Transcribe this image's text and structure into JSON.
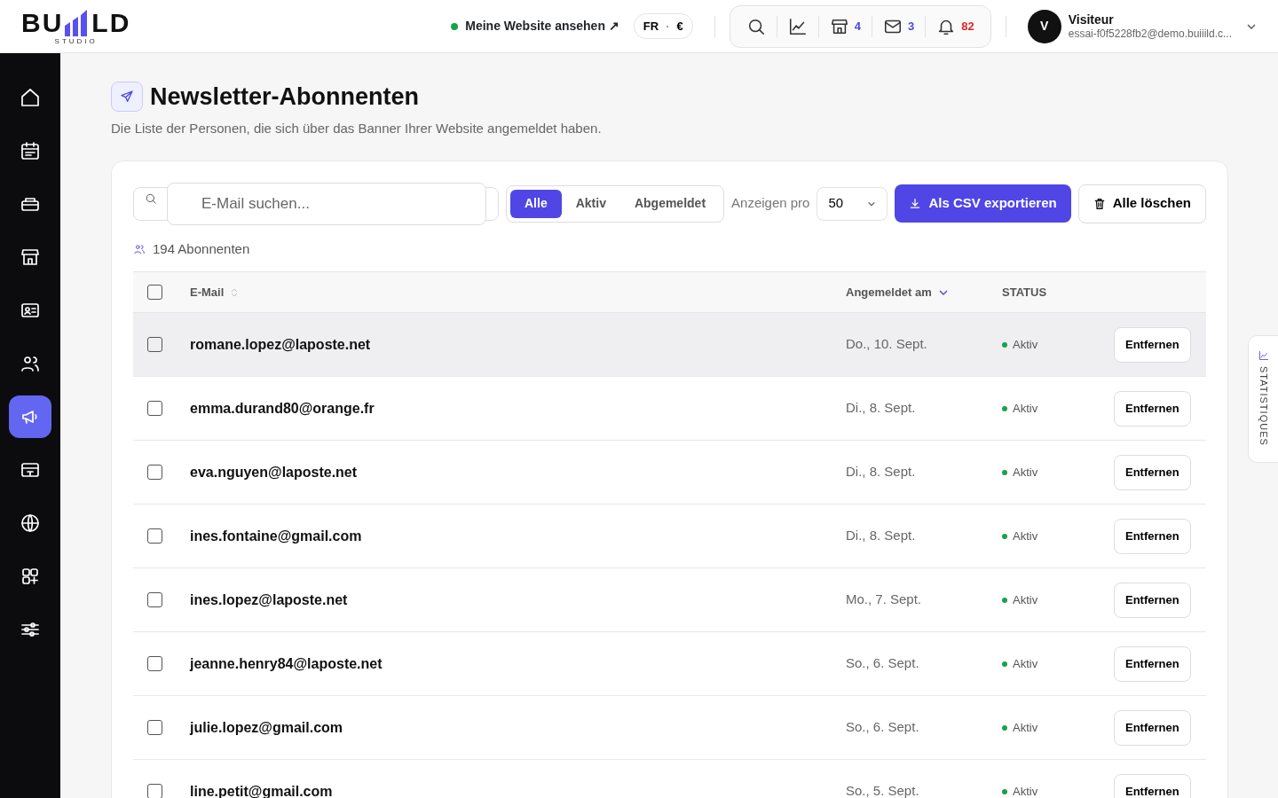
{
  "header": {
    "logo_text_left": "BU",
    "logo_text_right": "LD",
    "logo_sub": "STUDIO",
    "site_link": "Meine Website ansehen ↗",
    "locale": {
      "lang": "FR",
      "sep": "·",
      "currency": "€"
    },
    "toolbar": [
      {
        "kind": "search"
      },
      {
        "kind": "chart"
      },
      {
        "kind": "store",
        "count": "4",
        "color": "#4f46e5"
      },
      {
        "kind": "mail",
        "count": "3",
        "color": "#4f46e5"
      },
      {
        "kind": "bell",
        "count": "82",
        "color": "#dc2626"
      }
    ],
    "user": {
      "initial": "V",
      "name": "Visiteur",
      "email": "essai-f0f5228fb2@demo.buiiild.c..."
    }
  },
  "sidebar": {
    "items": [
      {
        "selected": false
      },
      {
        "selected": false
      },
      {
        "selected": false
      },
      {
        "selected": false
      },
      {
        "selected": false
      },
      {
        "selected": false
      },
      {
        "selected": true
      },
      {
        "selected": false
      },
      {
        "selected": false
      },
      {
        "selected": false
      },
      {
        "selected": false
      }
    ]
  },
  "page": {
    "title": "Newsletter-Abonnenten",
    "subtitle": "Die Liste der Personen, die sich über das Banner Ihrer Website angemeldet haben."
  },
  "search": {
    "placeholder": "E-Mail suchen..."
  },
  "filters": [
    {
      "label": "Alle",
      "selected": true
    },
    {
      "label": "Aktiv",
      "selected": false
    },
    {
      "label": "Abgemeldet",
      "selected": false
    }
  ],
  "per_page": {
    "label": "Anzeigen pro",
    "value": "50"
  },
  "export_button": "Als CSV exportieren",
  "delete_all_button": "Alle löschen",
  "count": "194 Abonnenten",
  "table": {
    "select_all_checked": false,
    "columns": [
      "E-Mail",
      "Angemeldet am",
      "STATUS"
    ],
    "rows": [
      {
        "email": "romane.lopez@laposte.net",
        "date": "Do., 10. Sept.",
        "status": "Aktiv",
        "action": "Entfernen",
        "checked": false,
        "hovered": true
      },
      {
        "email": "emma.durand80@orange.fr",
        "date": "Di., 8. Sept.",
        "status": "Aktiv",
        "action": "Entfernen",
        "checked": false,
        "hovered": false
      },
      {
        "email": "eva.nguyen@laposte.net",
        "date": "Di., 8. Sept.",
        "status": "Aktiv",
        "action": "Entfernen",
        "checked": false,
        "hovered": false
      },
      {
        "email": "ines.fontaine@gmail.com",
        "date": "Di., 8. Sept.",
        "status": "Aktiv",
        "action": "Entfernen",
        "checked": false,
        "hovered": false
      },
      {
        "email": "ines.lopez@laposte.net",
        "date": "Mo., 7. Sept.",
        "status": "Aktiv",
        "action": "Entfernen",
        "checked": false,
        "hovered": false
      },
      {
        "email": "jeanne.henry84@laposte.net",
        "date": "So., 6. Sept.",
        "status": "Aktiv",
        "action": "Entfernen",
        "checked": false,
        "hovered": false
      },
      {
        "email": "julie.lopez@gmail.com",
        "date": "So., 6. Sept.",
        "status": "Aktiv",
        "action": "Entfernen",
        "checked": false,
        "hovered": false
      },
      {
        "email": "line.petit@gmail.com",
        "date": "So., 5. Sept.",
        "status": "Aktiv",
        "action": "Entfernen",
        "checked": false,
        "hovered": false
      }
    ]
  },
  "side_tab": "STATISTIQUES"
}
